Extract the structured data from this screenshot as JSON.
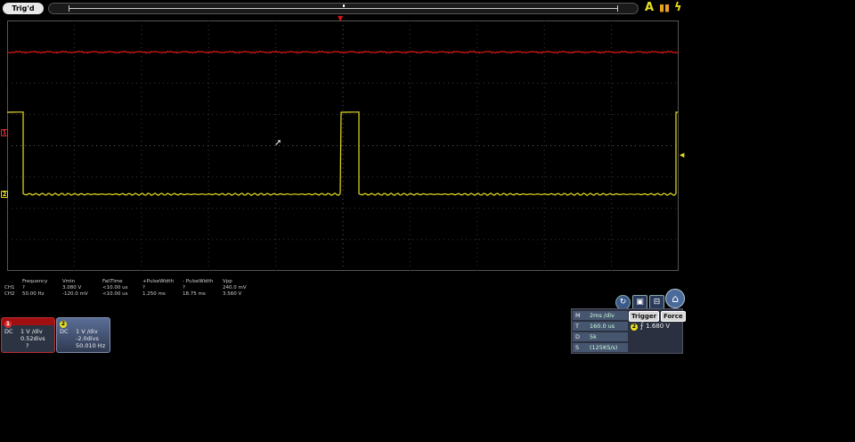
{
  "topbar": {
    "trigger_status": "Trig'd",
    "icons": [
      "autoset-icon",
      "run-stop-icon",
      "single-trigger-icon"
    ]
  },
  "colors": {
    "ch1": "#e01818",
    "ch2": "#e8e020",
    "grid": "#3a3a3a",
    "panel": "#47566f"
  },
  "screen": {
    "ch1_marker": "1",
    "ch2_marker": "2",
    "trigger_marker": "◀"
  },
  "measurements": {
    "headers": [
      "",
      "Frequency",
      "Vmin",
      "FallTime",
      "+PulseWidth",
      "- PulseWidth",
      "Vpp"
    ],
    "rows": [
      [
        "CH1",
        "?",
        "3.080 V",
        "<10.00 us",
        "?",
        "?",
        "240.0 mV"
      ],
      [
        "CH2",
        "50.00 Hz",
        "-120.0 mV",
        "<10.00 us",
        "1.250 ms",
        "18.75 ms",
        "3.560 V"
      ]
    ]
  },
  "channels": [
    {
      "num": "1",
      "coupling": "DC",
      "scale": "1 V /div",
      "offset": "0.52divs",
      "freq": "?"
    },
    {
      "num": "2",
      "coupling": "DC",
      "scale": "1 V /div",
      "offset": "-2.0divs",
      "freq": "50.010 Hz"
    }
  ],
  "timebase": {
    "rows": [
      {
        "key": "M",
        "value": "2ms /div"
      },
      {
        "key": "T",
        "value": "160.0 us"
      },
      {
        "key": "D",
        "value": "5k"
      },
      {
        "key": "S",
        "value": "(125KS/s)"
      }
    ],
    "trigger_label": "Trigger",
    "force_label": "Force",
    "trigger_source": "2",
    "trigger_level": "1.680 V"
  }
}
